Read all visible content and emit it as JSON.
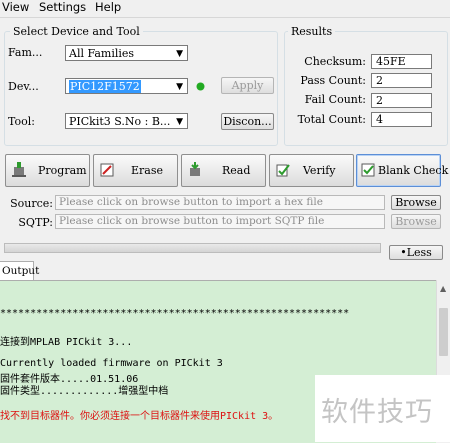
{
  "menu": {
    "items": [
      "View",
      "Settings",
      "Help"
    ]
  },
  "device_group": {
    "title": "Select Device and Tool",
    "family_label": "Fam...",
    "family_value": "All Families",
    "device_label": "Dev...",
    "device_value": "PIC12F1572",
    "apply_label": "Apply",
    "tool_label": "Tool:",
    "tool_value": "PICkit3 S.No : B...",
    "disconnect_label": "Discon...",
    "status_color": "#22aa22"
  },
  "results": {
    "title": "Results",
    "checksum_label": "Checksum:",
    "checksum_value": "45FE",
    "pass_label": "Pass Count:",
    "pass_value": "2",
    "fail_label": "Fail Count:",
    "fail_value": "2",
    "total_label": "Total Count:",
    "total_value": "4"
  },
  "actions": {
    "program": "Program",
    "erase": "Erase",
    "read": "Read",
    "verify": "Verify",
    "blank_check": "Blank Check"
  },
  "source": {
    "label": "Source:",
    "placeholder": "Please click on browse button to import a hex file",
    "browse": "Browse"
  },
  "sqtp": {
    "label": "SQTP:",
    "placeholder": "Please click on browse button to import SQTP file",
    "browse": "Browse"
  },
  "less_label": "•Less",
  "output": {
    "tab_label": "Output",
    "lines": [
      "**********************************************************",
      "连接到MPLAB PICkit 3...",
      "Currently loaded firmware on PICkit 3",
      "固件套件版本.....01.51.06",
      "固件类型.............增强型中档",
      "找不到目标器件。你必须连接一个目标器件来使用PICkit 3。"
    ],
    "error_color": "#dd1111"
  },
  "watermark": "软件技巧"
}
